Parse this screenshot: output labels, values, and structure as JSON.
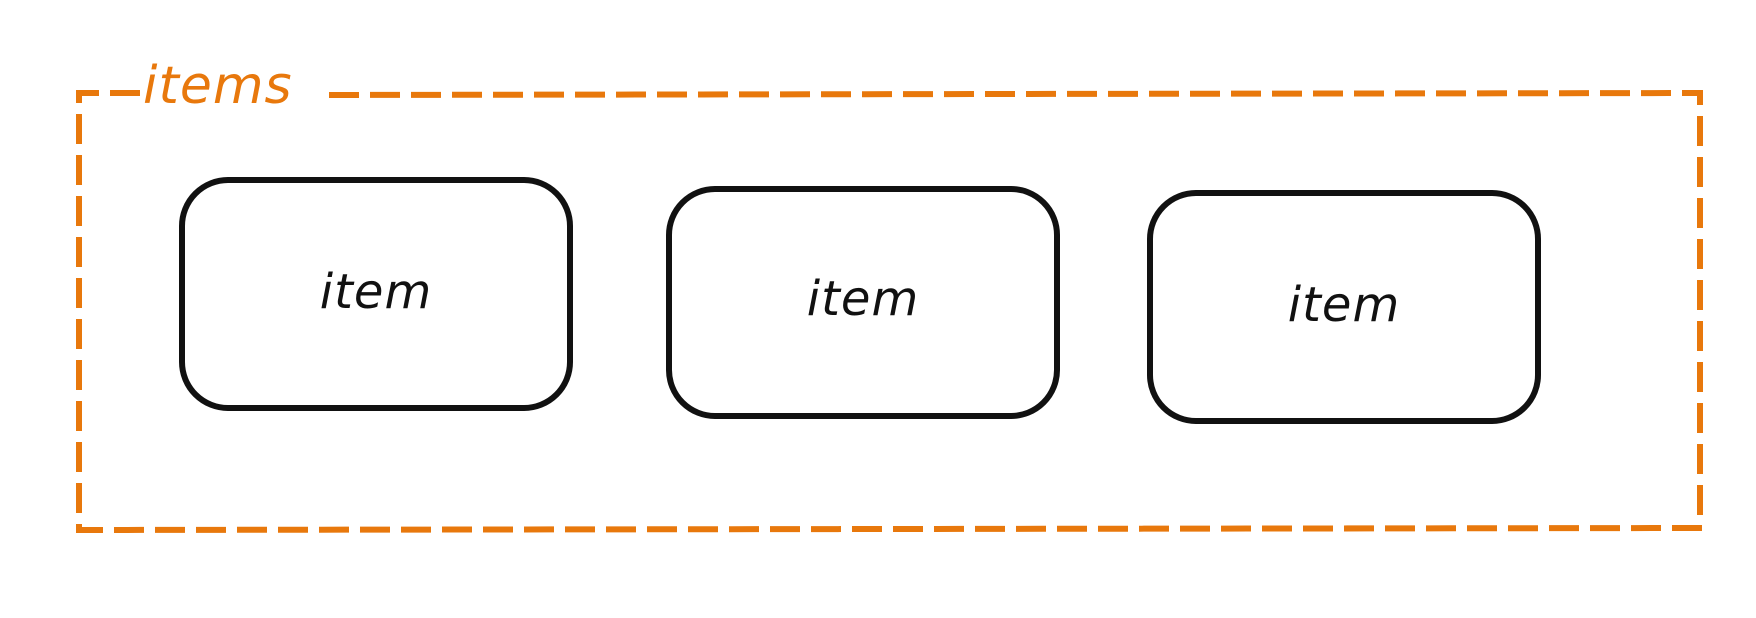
{
  "colors": {
    "container_stroke": "#e8780c",
    "container_label": "#e8780c",
    "item_stroke": "#111111",
    "item_label": "#111111",
    "background": "#ffffff"
  },
  "container": {
    "label": "items",
    "style": "dashed"
  },
  "items": [
    {
      "label": "item"
    },
    {
      "label": "item"
    },
    {
      "label": "item"
    }
  ]
}
